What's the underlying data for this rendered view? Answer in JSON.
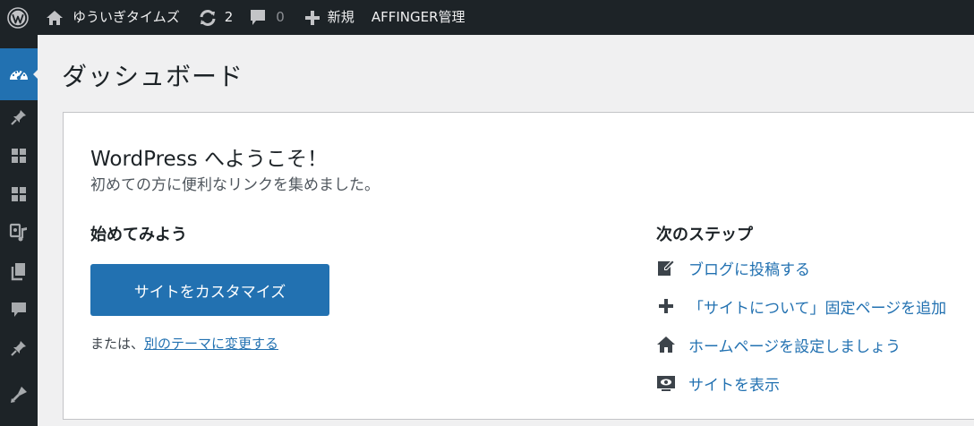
{
  "admin_bar": {
    "site_name": "ゆういぎタイムズ",
    "updates_count": "2",
    "comments_count": "0",
    "new_label": "新規",
    "affinger_label": "AFFINGER管理"
  },
  "page": {
    "title": "ダッシュボード"
  },
  "welcome": {
    "title": "WordPress へようこそ！",
    "subtitle": "初めての方に便利なリンクを集めました。",
    "start_heading": "始めてみよう",
    "customize_label": "サイトをカスタマイズ",
    "alt_prefix": "または、",
    "alt_link": "別のテーマに変更する",
    "next_heading": "次のステップ",
    "steps": [
      {
        "label": "ブログに投稿する",
        "icon": "edit-icon"
      },
      {
        "label": "「サイトについて」固定ページを追加",
        "icon": "plus-icon"
      },
      {
        "label": "ホームページを設定しましょう",
        "icon": "home-icon"
      },
      {
        "label": "サイトを表示",
        "icon": "view-icon"
      }
    ]
  },
  "colors": {
    "admin_bar_bg": "#1d2327",
    "accent": "#2271b1",
    "page_bg": "#f0f0f1"
  }
}
